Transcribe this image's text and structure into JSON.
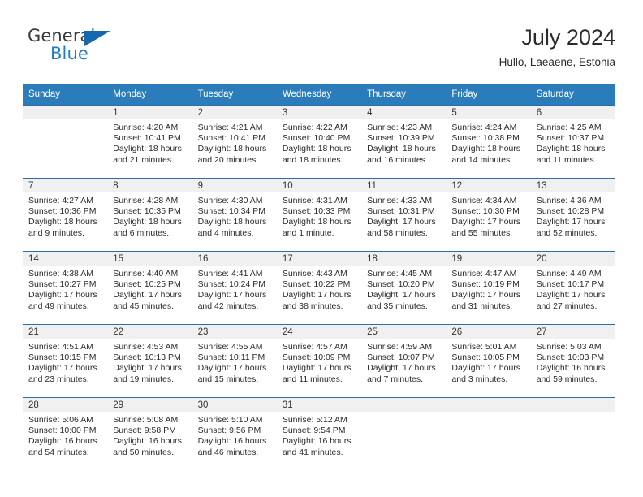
{
  "brand": {
    "name_top": "General",
    "name_bottom": "Blue",
    "triangle_color": "#1568b0",
    "blue_text_color": "#1f7fc4"
  },
  "header": {
    "title": "July 2024",
    "subtitle": "Hullo, Laeaene, Estonia"
  },
  "theme": {
    "header_bg": "#2b7cba",
    "row_divider": "#2b6ea8",
    "day_number_bg": "#f0f0f0",
    "text": "#2b2b2b"
  },
  "weekdays": [
    "Sunday",
    "Monday",
    "Tuesday",
    "Wednesday",
    "Thursday",
    "Friday",
    "Saturday"
  ],
  "weeks": [
    [
      {
        "day": "",
        "sunrise": "",
        "sunset": "",
        "daylight_line1": "",
        "daylight_line2": "",
        "empty": true
      },
      {
        "day": "1",
        "sunrise": "Sunrise: 4:20 AM",
        "sunset": "Sunset: 10:41 PM",
        "daylight_line1": "Daylight: 18 hours",
        "daylight_line2": "and 21 minutes."
      },
      {
        "day": "2",
        "sunrise": "Sunrise: 4:21 AM",
        "sunset": "Sunset: 10:41 PM",
        "daylight_line1": "Daylight: 18 hours",
        "daylight_line2": "and 20 minutes."
      },
      {
        "day": "3",
        "sunrise": "Sunrise: 4:22 AM",
        "sunset": "Sunset: 10:40 PM",
        "daylight_line1": "Daylight: 18 hours",
        "daylight_line2": "and 18 minutes."
      },
      {
        "day": "4",
        "sunrise": "Sunrise: 4:23 AM",
        "sunset": "Sunset: 10:39 PM",
        "daylight_line1": "Daylight: 18 hours",
        "daylight_line2": "and 16 minutes."
      },
      {
        "day": "5",
        "sunrise": "Sunrise: 4:24 AM",
        "sunset": "Sunset: 10:38 PM",
        "daylight_line1": "Daylight: 18 hours",
        "daylight_line2": "and 14 minutes."
      },
      {
        "day": "6",
        "sunrise": "Sunrise: 4:25 AM",
        "sunset": "Sunset: 10:37 PM",
        "daylight_line1": "Daylight: 18 hours",
        "daylight_line2": "and 11 minutes."
      }
    ],
    [
      {
        "day": "7",
        "sunrise": "Sunrise: 4:27 AM",
        "sunset": "Sunset: 10:36 PM",
        "daylight_line1": "Daylight: 18 hours",
        "daylight_line2": "and 9 minutes."
      },
      {
        "day": "8",
        "sunrise": "Sunrise: 4:28 AM",
        "sunset": "Sunset: 10:35 PM",
        "daylight_line1": "Daylight: 18 hours",
        "daylight_line2": "and 6 minutes."
      },
      {
        "day": "9",
        "sunrise": "Sunrise: 4:30 AM",
        "sunset": "Sunset: 10:34 PM",
        "daylight_line1": "Daylight: 18 hours",
        "daylight_line2": "and 4 minutes."
      },
      {
        "day": "10",
        "sunrise": "Sunrise: 4:31 AM",
        "sunset": "Sunset: 10:33 PM",
        "daylight_line1": "Daylight: 18 hours",
        "daylight_line2": "and 1 minute."
      },
      {
        "day": "11",
        "sunrise": "Sunrise: 4:33 AM",
        "sunset": "Sunset: 10:31 PM",
        "daylight_line1": "Daylight: 17 hours",
        "daylight_line2": "and 58 minutes."
      },
      {
        "day": "12",
        "sunrise": "Sunrise: 4:34 AM",
        "sunset": "Sunset: 10:30 PM",
        "daylight_line1": "Daylight: 17 hours",
        "daylight_line2": "and 55 minutes."
      },
      {
        "day": "13",
        "sunrise": "Sunrise: 4:36 AM",
        "sunset": "Sunset: 10:28 PM",
        "daylight_line1": "Daylight: 17 hours",
        "daylight_line2": "and 52 minutes."
      }
    ],
    [
      {
        "day": "14",
        "sunrise": "Sunrise: 4:38 AM",
        "sunset": "Sunset: 10:27 PM",
        "daylight_line1": "Daylight: 17 hours",
        "daylight_line2": "and 49 minutes."
      },
      {
        "day": "15",
        "sunrise": "Sunrise: 4:40 AM",
        "sunset": "Sunset: 10:25 PM",
        "daylight_line1": "Daylight: 17 hours",
        "daylight_line2": "and 45 minutes."
      },
      {
        "day": "16",
        "sunrise": "Sunrise: 4:41 AM",
        "sunset": "Sunset: 10:24 PM",
        "daylight_line1": "Daylight: 17 hours",
        "daylight_line2": "and 42 minutes."
      },
      {
        "day": "17",
        "sunrise": "Sunrise: 4:43 AM",
        "sunset": "Sunset: 10:22 PM",
        "daylight_line1": "Daylight: 17 hours",
        "daylight_line2": "and 38 minutes."
      },
      {
        "day": "18",
        "sunrise": "Sunrise: 4:45 AM",
        "sunset": "Sunset: 10:20 PM",
        "daylight_line1": "Daylight: 17 hours",
        "daylight_line2": "and 35 minutes."
      },
      {
        "day": "19",
        "sunrise": "Sunrise: 4:47 AM",
        "sunset": "Sunset: 10:19 PM",
        "daylight_line1": "Daylight: 17 hours",
        "daylight_line2": "and 31 minutes."
      },
      {
        "day": "20",
        "sunrise": "Sunrise: 4:49 AM",
        "sunset": "Sunset: 10:17 PM",
        "daylight_line1": "Daylight: 17 hours",
        "daylight_line2": "and 27 minutes."
      }
    ],
    [
      {
        "day": "21",
        "sunrise": "Sunrise: 4:51 AM",
        "sunset": "Sunset: 10:15 PM",
        "daylight_line1": "Daylight: 17 hours",
        "daylight_line2": "and 23 minutes."
      },
      {
        "day": "22",
        "sunrise": "Sunrise: 4:53 AM",
        "sunset": "Sunset: 10:13 PM",
        "daylight_line1": "Daylight: 17 hours",
        "daylight_line2": "and 19 minutes."
      },
      {
        "day": "23",
        "sunrise": "Sunrise: 4:55 AM",
        "sunset": "Sunset: 10:11 PM",
        "daylight_line1": "Daylight: 17 hours",
        "daylight_line2": "and 15 minutes."
      },
      {
        "day": "24",
        "sunrise": "Sunrise: 4:57 AM",
        "sunset": "Sunset: 10:09 PM",
        "daylight_line1": "Daylight: 17 hours",
        "daylight_line2": "and 11 minutes."
      },
      {
        "day": "25",
        "sunrise": "Sunrise: 4:59 AM",
        "sunset": "Sunset: 10:07 PM",
        "daylight_line1": "Daylight: 17 hours",
        "daylight_line2": "and 7 minutes."
      },
      {
        "day": "26",
        "sunrise": "Sunrise: 5:01 AM",
        "sunset": "Sunset: 10:05 PM",
        "daylight_line1": "Daylight: 17 hours",
        "daylight_line2": "and 3 minutes."
      },
      {
        "day": "27",
        "sunrise": "Sunrise: 5:03 AM",
        "sunset": "Sunset: 10:03 PM",
        "daylight_line1": "Daylight: 16 hours",
        "daylight_line2": "and 59 minutes."
      }
    ],
    [
      {
        "day": "28",
        "sunrise": "Sunrise: 5:06 AM",
        "sunset": "Sunset: 10:00 PM",
        "daylight_line1": "Daylight: 16 hours",
        "daylight_line2": "and 54 minutes."
      },
      {
        "day": "29",
        "sunrise": "Sunrise: 5:08 AM",
        "sunset": "Sunset: 9:58 PM",
        "daylight_line1": "Daylight: 16 hours",
        "daylight_line2": "and 50 minutes."
      },
      {
        "day": "30",
        "sunrise": "Sunrise: 5:10 AM",
        "sunset": "Sunset: 9:56 PM",
        "daylight_line1": "Daylight: 16 hours",
        "daylight_line2": "and 46 minutes."
      },
      {
        "day": "31",
        "sunrise": "Sunrise: 5:12 AM",
        "sunset": "Sunset: 9:54 PM",
        "daylight_line1": "Daylight: 16 hours",
        "daylight_line2": "and 41 minutes."
      },
      {
        "day": "",
        "sunrise": "",
        "sunset": "",
        "daylight_line1": "",
        "daylight_line2": "",
        "empty": true
      },
      {
        "day": "",
        "sunrise": "",
        "sunset": "",
        "daylight_line1": "",
        "daylight_line2": "",
        "empty": true
      },
      {
        "day": "",
        "sunrise": "",
        "sunset": "",
        "daylight_line1": "",
        "daylight_line2": "",
        "empty": true
      }
    ]
  ]
}
